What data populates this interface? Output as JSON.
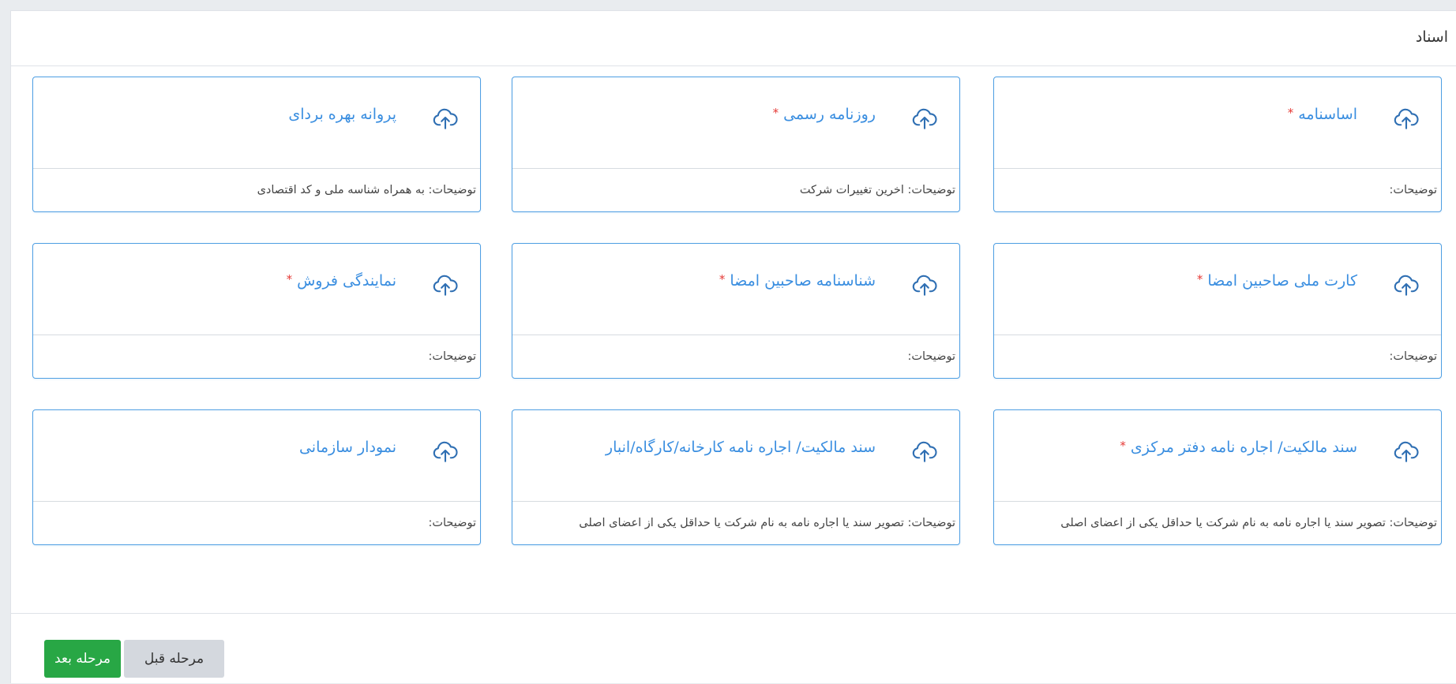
{
  "panel": {
    "title": "اسناد"
  },
  "cards": [
    {
      "title": "اساسنامه",
      "required": "*",
      "description": "توضیحات:"
    },
    {
      "title": "روزنامه رسمی",
      "required": "*",
      "description": "توضیحات: اخرین تغییرات شرکت"
    },
    {
      "title": "پروانه بهره بردای",
      "required": "",
      "description": "توضیحات: به همراه شناسه ملی و کد اقتصادی"
    },
    {
      "title": "کارت ملی صاحبین امضا",
      "required": "*",
      "description": "توضیحات:"
    },
    {
      "title": "شناسنامه صاحبین امضا",
      "required": "*",
      "description": "توضیحات:"
    },
    {
      "title": "نمایندگی فروش",
      "required": "*",
      "description": "توضیحات:"
    },
    {
      "title": "سند مالکیت/ اجاره نامه دفتر مرکزی",
      "required": "*",
      "description": "توضیحات: تصویر سند یا اجاره نامه به نام شرکت یا حداقل یکی از اعضای اصلی"
    },
    {
      "title": "سند مالکیت/ اجاره نامه کارخانه/کارگاه/انبار",
      "required": "",
      "description": "توضیحات: تصویر سند یا اجاره نامه به نام شرکت یا حداقل یکی از اعضای اصلی"
    },
    {
      "title": "نمودار سازمانی",
      "required": "",
      "description": "توضیحات:"
    }
  ],
  "icons": {
    "upload": "cloud-upload-icon"
  },
  "footer": {
    "next_label": "مرحله بعد",
    "prev_label": "مرحله قبل"
  },
  "colors": {
    "accent": "#3a8ee0",
    "card_border": "#4f9fe3",
    "required": "#e53935",
    "next_button": "#28a745",
    "prev_button": "#d4d8de"
  }
}
